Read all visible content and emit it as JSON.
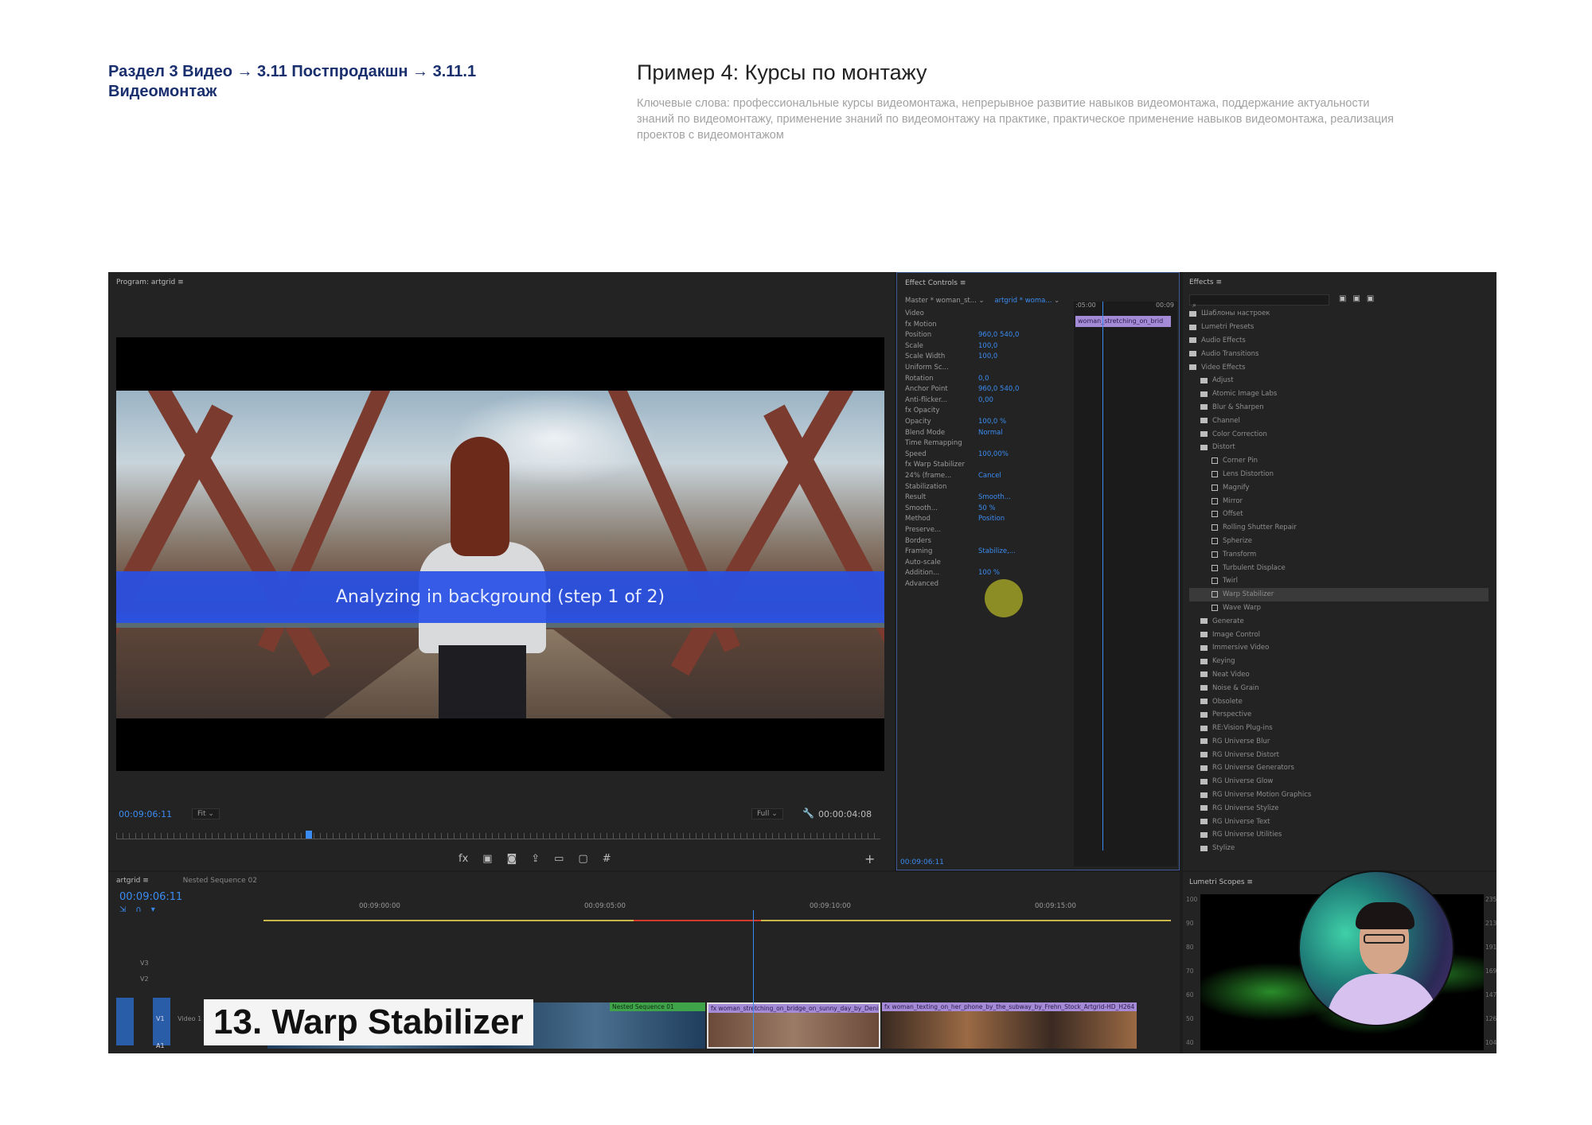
{
  "header": {
    "breadcrumb": "Раздел 3 Видео  → 3.11 Постпродакшн → 3.11.1 Видеомонтаж",
    "title": "Пример 4: Курсы по монтажу",
    "keywords": "Ключевые слова: профессиональные курсы видеомонтажа, непрерывное развитие навыков видеомонтажа,  поддержание актуальности знаний по видеомонтажу, применение знаний по видеомонтажу на практике, практическое применение навыков видеомонтажа, реализация проектов с видеомонтажом"
  },
  "program": {
    "header": "Program: artgrid  ≡",
    "overlay_text": "Analyzing in background (step 1 of 2)",
    "timecode": "00:09:06:11",
    "fit": "Fit",
    "quality": "Full",
    "duration": "00:00:04:08"
  },
  "effect_controls": {
    "header": "Effect Controls  ≡",
    "master": "Master * woman_st...",
    "sequence": "artgrid * woma...",
    "ruler_start": ":05:00",
    "ruler_end": "00:09",
    "clip_label": "woman_stretching_on_brid",
    "rows": [
      {
        "label": "Video",
        "value": ""
      },
      {
        "label": "fx  Motion",
        "value": ""
      },
      {
        "label": "Position",
        "value": "960,0     540,0"
      },
      {
        "label": "Scale",
        "value": "100,0"
      },
      {
        "label": "Scale Width",
        "value": "100,0"
      },
      {
        "label": "Uniform Sc...",
        "value": ""
      },
      {
        "label": "Rotation",
        "value": "0,0"
      },
      {
        "label": "Anchor Point",
        "value": "960,0     540,0"
      },
      {
        "label": "Anti-flicker...",
        "value": "0,00"
      },
      {
        "label": "fx  Opacity",
        "value": ""
      },
      {
        "label": "Opacity",
        "value": "100,0 %"
      },
      {
        "label": "Blend Mode",
        "value": "Normal"
      },
      {
        "label": "Time Remapping",
        "value": ""
      },
      {
        "label": "Speed",
        "value": "100,00%"
      },
      {
        "label": "fx  Warp Stabilizer",
        "value": ""
      },
      {
        "label": "24% (frame...",
        "value": "Cancel"
      },
      {
        "label": "Stabilization",
        "value": ""
      },
      {
        "label": "Result",
        "value": "Smooth..."
      },
      {
        "label": "Smooth...",
        "value": "50 %"
      },
      {
        "label": "Method",
        "value": "Position"
      },
      {
        "label": "Preserve...",
        "value": ""
      },
      {
        "label": "Borders",
        "value": ""
      },
      {
        "label": "Framing",
        "value": "Stabilize,..."
      },
      {
        "label": "Auto-scale",
        "value": ""
      },
      {
        "label": "Addition...",
        "value": "100 %"
      },
      {
        "label": "Advanced",
        "value": ""
      }
    ],
    "footer_tc": "00:09:06:11"
  },
  "effects": {
    "header": "Effects  ≡",
    "items": [
      {
        "label": "Шаблоны настроек",
        "indent": 0,
        "type": "folder"
      },
      {
        "label": "Lumetri Presets",
        "indent": 0,
        "type": "folder"
      },
      {
        "label": "Audio Effects",
        "indent": 0,
        "type": "folder"
      },
      {
        "label": "Audio Transitions",
        "indent": 0,
        "type": "folder"
      },
      {
        "label": "Video Effects",
        "indent": 0,
        "type": "folder"
      },
      {
        "label": "Adjust",
        "indent": 1,
        "type": "folder"
      },
      {
        "label": "Atomic Image Labs",
        "indent": 1,
        "type": "folder"
      },
      {
        "label": "Blur & Sharpen",
        "indent": 1,
        "type": "folder"
      },
      {
        "label": "Channel",
        "indent": 1,
        "type": "folder"
      },
      {
        "label": "Color Correction",
        "indent": 1,
        "type": "folder"
      },
      {
        "label": "Distort",
        "indent": 1,
        "type": "folder"
      },
      {
        "label": "Corner Pin",
        "indent": 2,
        "type": "effect"
      },
      {
        "label": "Lens Distortion",
        "indent": 2,
        "type": "effect"
      },
      {
        "label": "Magnify",
        "indent": 2,
        "type": "effect"
      },
      {
        "label": "Mirror",
        "indent": 2,
        "type": "effect"
      },
      {
        "label": "Offset",
        "indent": 2,
        "type": "effect"
      },
      {
        "label": "Rolling Shutter Repair",
        "indent": 2,
        "type": "effect"
      },
      {
        "label": "Spherize",
        "indent": 2,
        "type": "effect"
      },
      {
        "label": "Transform",
        "indent": 2,
        "type": "effect"
      },
      {
        "label": "Turbulent Displace",
        "indent": 2,
        "type": "effect"
      },
      {
        "label": "Twirl",
        "indent": 2,
        "type": "effect"
      },
      {
        "label": "Warp Stabilizer",
        "indent": 2,
        "type": "effect",
        "selected": true
      },
      {
        "label": "Wave Warp",
        "indent": 2,
        "type": "effect"
      },
      {
        "label": "Generate",
        "indent": 1,
        "type": "folder"
      },
      {
        "label": "Image Control",
        "indent": 1,
        "type": "folder"
      },
      {
        "label": "Immersive Video",
        "indent": 1,
        "type": "folder"
      },
      {
        "label": "Keying",
        "indent": 1,
        "type": "folder"
      },
      {
        "label": "Neat Video",
        "indent": 1,
        "type": "folder"
      },
      {
        "label": "Noise & Grain",
        "indent": 1,
        "type": "folder"
      },
      {
        "label": "Obsolete",
        "indent": 1,
        "type": "folder"
      },
      {
        "label": "Perspective",
        "indent": 1,
        "type": "folder"
      },
      {
        "label": "RE:Vision Plug-ins",
        "indent": 1,
        "type": "folder"
      },
      {
        "label": "RG Universe Blur",
        "indent": 1,
        "type": "folder"
      },
      {
        "label": "RG Universe Distort",
        "indent": 1,
        "type": "folder"
      },
      {
        "label": "RG Universe Generators",
        "indent": 1,
        "type": "folder"
      },
      {
        "label": "RG Universe Glow",
        "indent": 1,
        "type": "folder"
      },
      {
        "label": "RG Universe Motion Graphics",
        "indent": 1,
        "type": "folder"
      },
      {
        "label": "RG Universe Stylize",
        "indent": 1,
        "type": "folder"
      },
      {
        "label": "RG Universe Text",
        "indent": 1,
        "type": "folder"
      },
      {
        "label": "RG Universe Utilities",
        "indent": 1,
        "type": "folder"
      },
      {
        "label": "Stylize",
        "indent": 1,
        "type": "folder"
      }
    ]
  },
  "timeline": {
    "tab": "artgrid  ≡",
    "nested_tab": "Nested Sequence 02",
    "timecode": "00:09:06:11",
    "ruler": [
      "00:09:00:00",
      "00:09:05:00",
      "00:09:10:00",
      "00:09:15:00"
    ],
    "tracks": [
      "V3",
      "V2",
      "V1",
      "A1"
    ],
    "track_name_v1": "Video 1",
    "caption": "13. Warp Stabilizer",
    "clips": [
      {
        "label": "Nested Sequence 01",
        "color": "#3fa34a"
      },
      {
        "label": "fx  woman_stretching_on_bridge_on_sunny_day_by_Denis_Ohanz_Artgrid-H",
        "color": "#a58ad8"
      },
      {
        "label": "fx  woman_texting_on_her_phone_by_the_subway_by_Frehn_Stock_Artgrid-HD_H264",
        "color": "#a58ad8"
      }
    ]
  },
  "lumetri": {
    "header": "Lumetri Scopes  ≡",
    "scale_left": [
      "100",
      "90",
      "80",
      "70",
      "60",
      "50",
      "40"
    ],
    "scale_right": [
      "235",
      "213",
      "191",
      "169",
      "147",
      "126",
      "104"
    ]
  },
  "colors": {
    "accent_blue": "#3b8cf2",
    "clip_purple": "#a58ad8",
    "clip_green": "#3fa34a",
    "breadcrumb": "#1a2f6e"
  }
}
